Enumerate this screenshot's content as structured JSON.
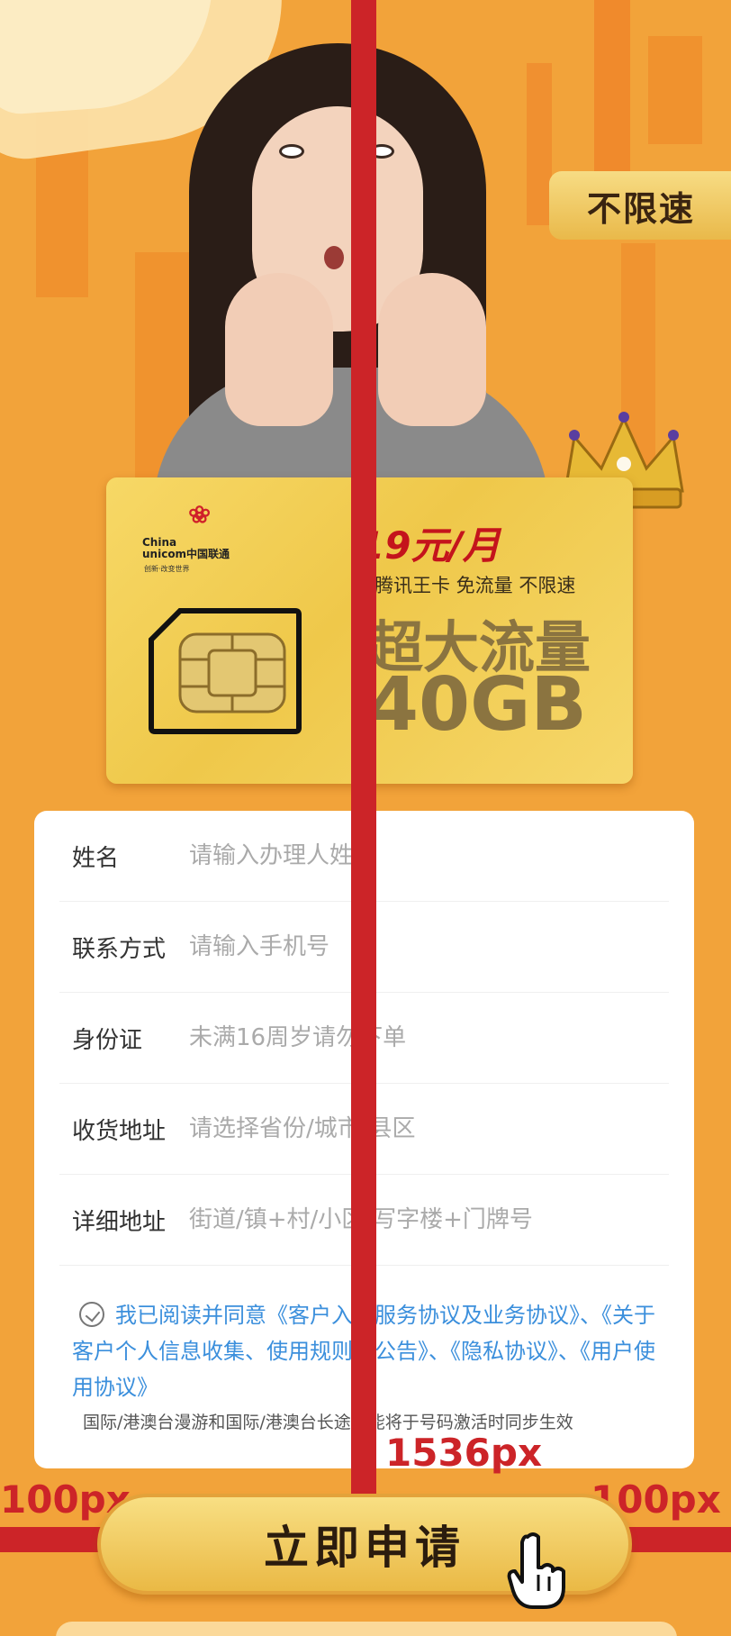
{
  "promo": {
    "speed_badge": "不限速",
    "card": {
      "brand_en_1": "China",
      "brand_en_2": "unicom中国联通",
      "slogan": "创新·改变世界",
      "price": "19元/月",
      "subtitle": "腾讯王卡 免流量 不限速",
      "headline": "超大流量",
      "data_amount": "40GB"
    }
  },
  "form": {
    "fields": [
      {
        "label": "姓名",
        "placeholder": "请输入办理人姓名"
      },
      {
        "label": "联系方式",
        "placeholder": "请输入手机号"
      },
      {
        "label": "身份证",
        "placeholder": "未满16周岁请勿下单"
      },
      {
        "label": "收货地址",
        "placeholder": "请选择省份/城市/县区"
      },
      {
        "label": "详细地址",
        "placeholder": "街道/镇+村/小区/写字楼+门牌号"
      }
    ],
    "agreement": "我已阅读并同意《客户入网服务协议及业务协议》、《关于客户个人信息收集、使用规则的公告》、《隐私协议》、《用户使用协议》",
    "note": "国际/港澳台漫游和国际/港澳台长途功能将于号码激活时同步生效"
  },
  "cta": {
    "label": "立即申请"
  },
  "annotations": {
    "height_label": "1536px",
    "left_margin_label": "100px",
    "right_margin_label": "100px"
  },
  "colors": {
    "background": "#f2a33a",
    "gold": "#efc84a",
    "annotation_red": "#cc2428",
    "price_red": "#c4141c",
    "link_blue": "#3b8fdc"
  }
}
